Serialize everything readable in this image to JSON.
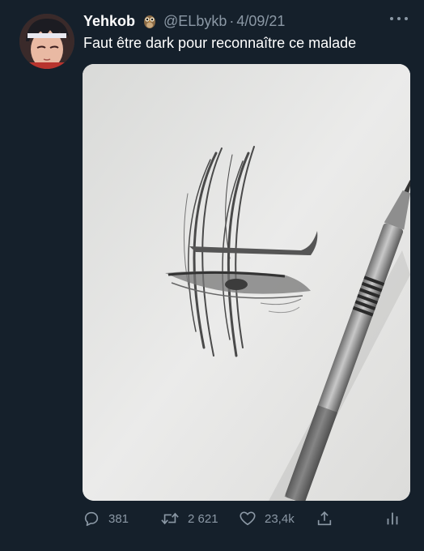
{
  "author": {
    "display_name": "Yehkob",
    "name_emoji_icon": "owl-icon",
    "handle": "@ELbykb",
    "separator": "·",
    "date": "4/09/21"
  },
  "tweet": {
    "text": "Faut être dark pour reconnaître ce malade"
  },
  "media": {
    "type": "photo",
    "subject": "pencil-sketch-with-mechanical-pencil"
  },
  "actions": {
    "reply": {
      "icon": "reply-icon",
      "count": "381"
    },
    "retweet": {
      "icon": "retweet-icon",
      "count": "2 621"
    },
    "like": {
      "icon": "heart-icon",
      "count": "23,4k"
    },
    "share": {
      "icon": "share-icon"
    },
    "analytics": {
      "icon": "analytics-icon"
    }
  },
  "colors": {
    "background": "#15202b",
    "text_primary": "#ffffff",
    "text_secondary": "#8b98a5"
  }
}
